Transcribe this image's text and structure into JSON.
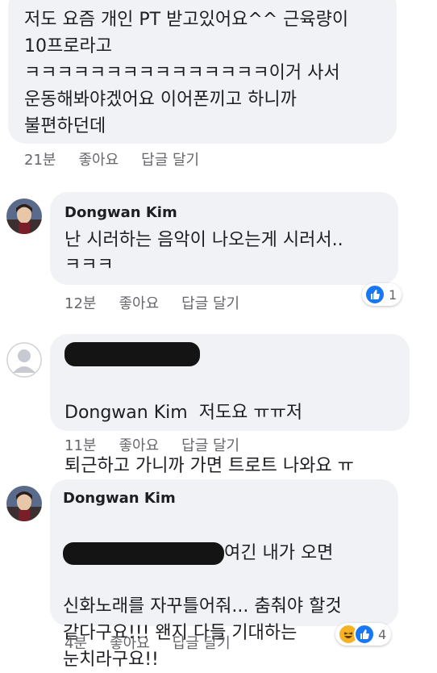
{
  "comments": [
    {
      "text": "저도 요즘 개인 PT 받고있어요^^ 근육량이\n10프로라고\nㅋㅋㅋㅋㅋㅋㅋㅋㅋㅋㅋㅋㅋㅋㅋ이거 사서\n운동해봐야겠어요 이어폰끼고 하니까\n불편하던데",
      "time": "21분",
      "like_label": "좋아요",
      "reply_label": "답글 달기"
    },
    {
      "author": "Dongwan Kim",
      "text": "난 시러하는 음악이 나오는게 시러서..\nㅋㅋㅋ",
      "time": "12분",
      "like_label": "좋아요",
      "reply_label": "답글 달기",
      "reaction_count": "1"
    },
    {
      "mention": "Dongwan Kim",
      "text_line1": "저도요 ㅠㅠ저",
      "text_line2": "퇴근하고 가니까 가면 트로트 나와요 ㅠ",
      "time": "11분",
      "like_label": "좋아요",
      "reply_label": "답글 달기"
    },
    {
      "author": "Dongwan Kim",
      "text_line1_suffix": "여긴 내가 오면",
      "text_rest": "신화노래를 자꾸틀어줘... 춤춰야 할것\n같다구요!!! 왠지 다들 기대하는\n눈치라구요!!",
      "time": "4분",
      "like_label": "좋아요",
      "reply_label": "답글 달기",
      "reaction_count": "4"
    }
  ],
  "icons": {
    "like": "like-icon",
    "haha": "haha-icon",
    "default_avatar": "default-avatar-icon",
    "profile_photo": "profile-photo"
  },
  "colors": {
    "bubble": "#f0f2f5",
    "like_blue": "#1877f2",
    "haha_yellow": "#f7b125",
    "meta_gray": "#65676b",
    "redaction": "#141414"
  }
}
